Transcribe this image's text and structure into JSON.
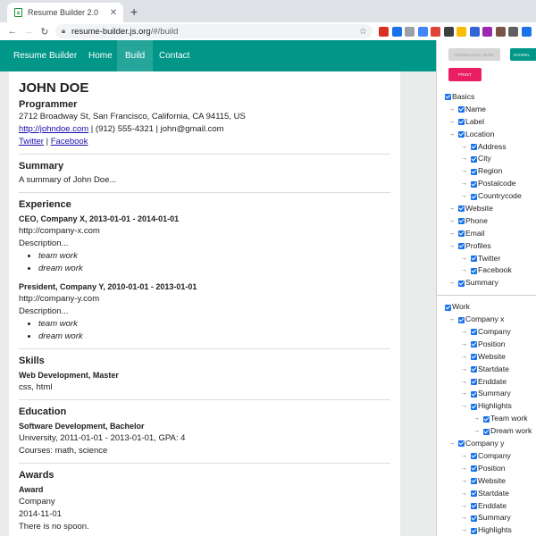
{
  "browser": {
    "tab_title": "Resume Builder 2.0",
    "url_host": "resume-builder.js.org",
    "url_path": "/#/build",
    "extension_colors": [
      "#d93025",
      "#1a73e8",
      "#9aa0a6",
      "#4285f4",
      "#db4437",
      "#3c4043",
      "#fbbc04",
      "#3367d6",
      "#9c27b0",
      "#795548",
      "#616161",
      "#1a73e8"
    ]
  },
  "app": {
    "brand": "Resume Builder",
    "nav": [
      "Home",
      "Build",
      "Contact"
    ],
    "active_nav": "Build",
    "colors": {
      "primary": "#009688",
      "active": "#26a69a",
      "print": "#e91e63"
    }
  },
  "resume": {
    "name": "JOHN DOE",
    "label": "Programmer",
    "address": "2712 Broadway St, San Francisco, California, CA 94115, US",
    "website": "http://johndoe.com",
    "contact_rest": " | (912) 555-4321 | john@gmail.com",
    "profiles": [
      "Twitter",
      "Facebook"
    ],
    "profile_sep": " | ",
    "summary_heading": "Summary",
    "summary": "A summary of John Doe...",
    "experience_heading": "Experience",
    "jobs": [
      {
        "title": "CEO, Company X, 2013-01-01 - 2014-01-01",
        "url": "http://company-x.com",
        "desc": "Description...",
        "highlights": [
          "team work",
          "dream work"
        ]
      },
      {
        "title": "President, Company Y, 2010-01-01 - 2013-01-01",
        "url": "http://company-y.com",
        "desc": "Description...",
        "highlights": [
          "team work",
          "dream work"
        ]
      }
    ],
    "skills_heading": "Skills",
    "skill_title": "Web Development, Master",
    "skill_keywords": "css, html",
    "education_heading": "Education",
    "edu_title": "Software Development, Bachelor",
    "edu_line": "University, 2011-01-01 - 2013-01-01, GPA: 4",
    "edu_courses": "Courses: math, science",
    "awards_heading": "Awards",
    "award_title": "Award",
    "award_org": "Company",
    "award_date": "2014-11-01",
    "award_summary": "There is no spoon."
  },
  "panel": {
    "btn_download_disabled": "DOWNLOAD JSON",
    "btn_download": "DOWNL",
    "btn_print": "PRINT",
    "basics_label": "Basics",
    "basics": [
      {
        "label": "Name",
        "level": 1
      },
      {
        "label": "Label",
        "level": 1
      },
      {
        "label": "Location",
        "level": 1
      },
      {
        "label": "Address",
        "level": 2
      },
      {
        "label": "City",
        "level": 2
      },
      {
        "label": "Region",
        "level": 2
      },
      {
        "label": "Postalcode",
        "level": 2
      },
      {
        "label": "Countrycode",
        "level": 2
      },
      {
        "label": "Website",
        "level": 1
      },
      {
        "label": "Phone",
        "level": 1
      },
      {
        "label": "Email",
        "level": 1
      },
      {
        "label": "Profiles",
        "level": 1
      },
      {
        "label": "Twitter",
        "level": 2
      },
      {
        "label": "Facebook",
        "level": 2
      },
      {
        "label": "Summary",
        "level": 1
      }
    ],
    "work_label": "Work",
    "work": [
      {
        "label": "Company x",
        "level": 1
      },
      {
        "label": "Company",
        "level": 2
      },
      {
        "label": "Position",
        "level": 2
      },
      {
        "label": "Website",
        "level": 2
      },
      {
        "label": "Startdate",
        "level": 2
      },
      {
        "label": "Enddate",
        "level": 2
      },
      {
        "label": "Summary",
        "level": 2
      },
      {
        "label": "Highlights",
        "level": 2
      },
      {
        "label": "Team work",
        "level": 3
      },
      {
        "label": "Dream work",
        "level": 3
      },
      {
        "label": "Company y",
        "level": 1
      },
      {
        "label": "Company",
        "level": 2
      },
      {
        "label": "Position",
        "level": 2
      },
      {
        "label": "Website",
        "level": 2
      },
      {
        "label": "Startdate",
        "level": 2
      },
      {
        "label": "Enddate",
        "level": 2
      },
      {
        "label": "Summary",
        "level": 2
      },
      {
        "label": "Highlights",
        "level": 2
      }
    ]
  }
}
